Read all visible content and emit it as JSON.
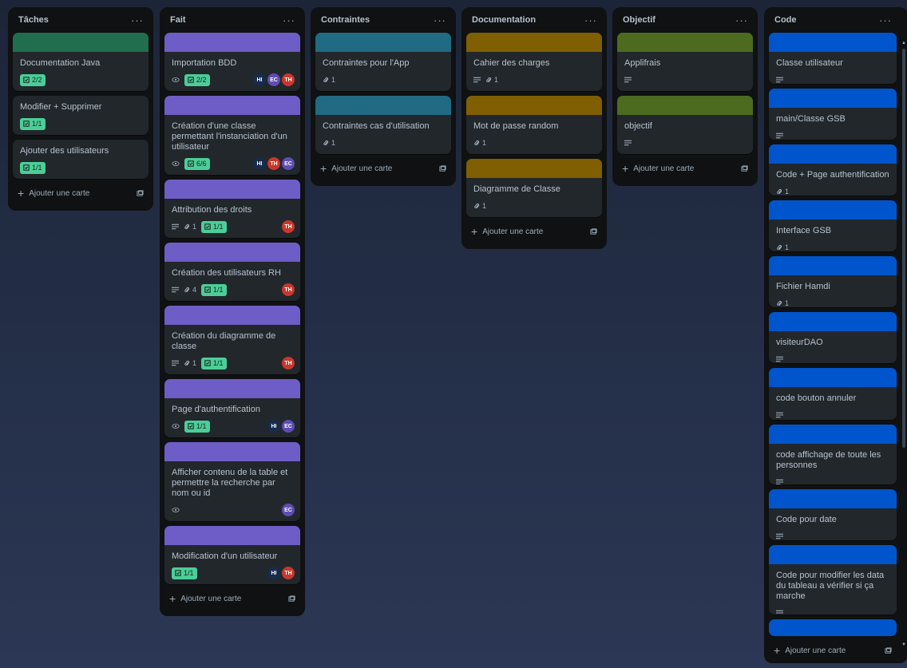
{
  "lists": [
    {
      "title": "Tâches",
      "add": "Ajouter une carte",
      "cards": [
        {
          "title": "Documentation Java",
          "cover": "#216e4e",
          "check": "2/2"
        },
        {
          "title": "Modifier + Supprimer",
          "check": "1/1"
        },
        {
          "title": "Ajouter des utilisateurs",
          "check": "1/1"
        }
      ]
    },
    {
      "title": "Fait",
      "add": "Ajouter une carte",
      "cards": [
        {
          "title": "Importation BDD",
          "cover": "#6e5dc6",
          "watch": true,
          "check": "2/2",
          "members": [
            "HI",
            "EC",
            "TH"
          ]
        },
        {
          "title": "Création d'une classe permettant l'instanciation d'un utilisateur",
          "cover": "#6e5dc6",
          "watch": true,
          "check": "6/6",
          "members": [
            "HI",
            "TH",
            "EC"
          ]
        },
        {
          "title": "Attribution des droits",
          "cover": "#6e5dc6",
          "desc": true,
          "attach": "1",
          "check": "1/1",
          "members": [
            "TH"
          ]
        },
        {
          "title": "Création des utilisateurs RH",
          "cover": "#6e5dc6",
          "desc": true,
          "attach": "4",
          "check": "1/1",
          "members": [
            "TH"
          ]
        },
        {
          "title": "Création du diagramme de classe",
          "cover": "#6e5dc6",
          "desc": true,
          "attach": "1",
          "check": "1/1",
          "members": [
            "TH"
          ]
        },
        {
          "title": "Page d'authentification",
          "cover": "#6e5dc6",
          "watch": true,
          "check": "1/1",
          "members": [
            "HI",
            "EC"
          ]
        },
        {
          "title": "Afficher contenu de la table et permettre la recherche par nom ou id",
          "cover": "#6e5dc6",
          "watch": true,
          "members": [
            "EC"
          ]
        },
        {
          "title": "Modification d'un utilisateur",
          "cover": "#6e5dc6",
          "check": "1/1",
          "members": [
            "HI",
            "TH"
          ]
        }
      ]
    },
    {
      "title": "Contraintes",
      "add": "Ajouter une carte",
      "cards": [
        {
          "title": "Contraintes pour l'App",
          "cover": "#206a83",
          "attach": "1"
        },
        {
          "title": "Contraintes cas d'utilisation",
          "cover": "#206a83",
          "attach": "1"
        }
      ]
    },
    {
      "title": "Documentation",
      "add": "Ajouter une carte",
      "cards": [
        {
          "title": "Cahier des charges",
          "cover": "#7f5f01",
          "desc": true,
          "attach": "1"
        },
        {
          "title": "Mot de passe random",
          "cover": "#7f5f01",
          "attach": "1"
        },
        {
          "title": "Diagramme de Classe",
          "cover": "#7f5f01",
          "attach": "1"
        }
      ]
    },
    {
      "title": "Objectif",
      "add": "Ajouter une carte",
      "cards": [
        {
          "title": "Applifrais",
          "cover": "#4c6b1f",
          "desc": true
        },
        {
          "title": "objectif",
          "cover": "#4c6b1f",
          "desc": true
        }
      ]
    },
    {
      "title": "Code",
      "add": "Ajouter une carte",
      "cards": [
        {
          "title": "Classe utilisateur",
          "cover": "#0055cc",
          "desc": true
        },
        {
          "title": "main/Classe GSB",
          "cover": "#0055cc",
          "desc": true
        },
        {
          "title": "Code + Page authentification",
          "cover": "#0055cc",
          "attach": "1"
        },
        {
          "title": "Interface GSB",
          "cover": "#0055cc",
          "attach": "1"
        },
        {
          "title": "Fichier Hamdi",
          "cover": "#0055cc",
          "attach": "1"
        },
        {
          "title": "visiteurDAO",
          "cover": "#0055cc",
          "desc": true
        },
        {
          "title": "code bouton annuler",
          "cover": "#0055cc",
          "desc": true
        },
        {
          "title": "code affichage de toute les personnes",
          "cover": "#0055cc",
          "desc": true
        },
        {
          "title": "Code pour date",
          "cover": "#0055cc",
          "desc": true
        },
        {
          "title": "Code pour modifier les data du tableau a vérifier si ça marche",
          "cover": "#0055cc",
          "desc": true
        },
        {
          "title": "",
          "cover": "#0055cc"
        }
      ]
    }
  ]
}
